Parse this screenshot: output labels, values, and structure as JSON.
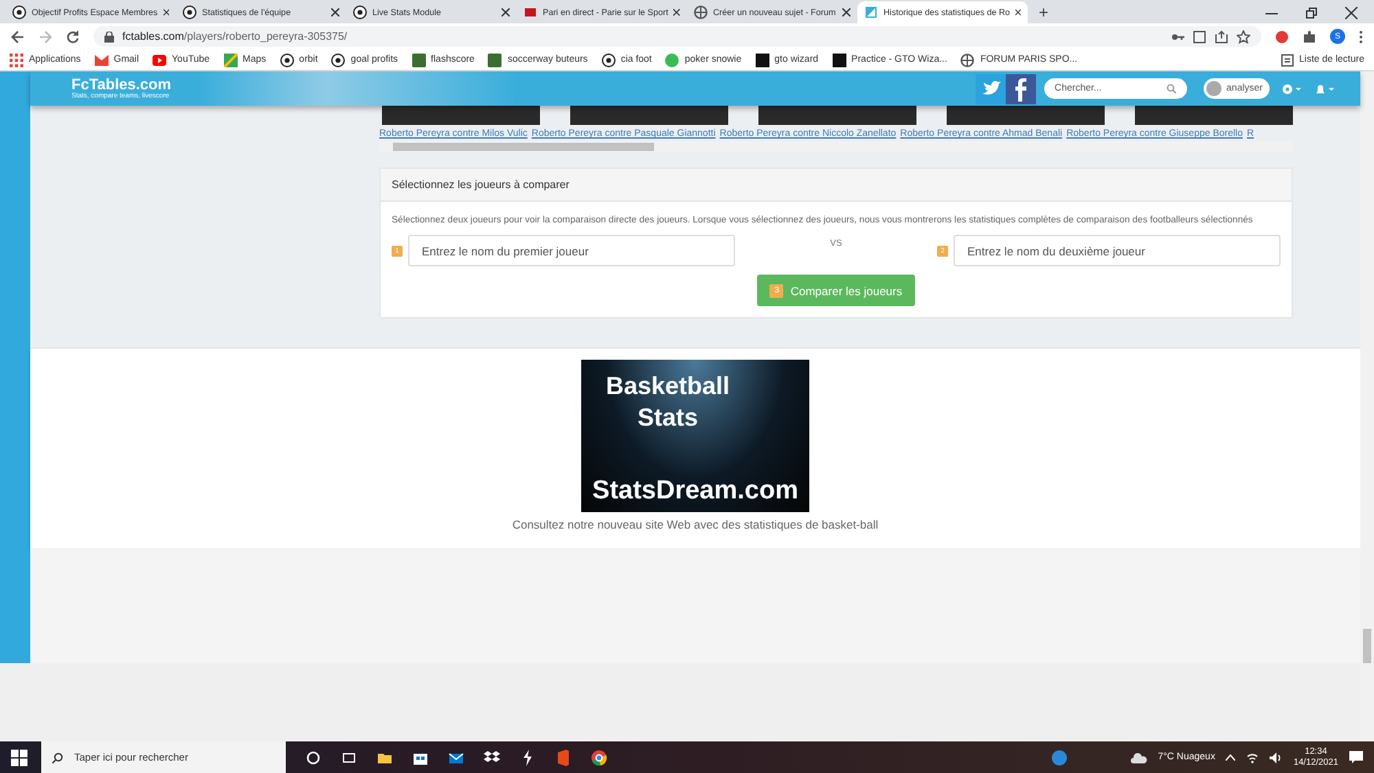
{
  "browser": {
    "tabs": [
      {
        "title": "Objectif Profits Espace Membres",
        "selected": false
      },
      {
        "title": "Statistiques de l'équipe",
        "selected": false
      },
      {
        "title": "Live Stats Module",
        "selected": false
      },
      {
        "title": "Pari en direct - Parie sur le Sport",
        "selected": false
      },
      {
        "title": "Créer un nouveau sujet - Forum",
        "selected": false
      },
      {
        "title": "Historique des statistiques de Ro",
        "selected": true
      }
    ],
    "new_tab": "+",
    "url_host": "fctables.com",
    "url_path": "/players/roberto_pereyra-305375/",
    "profile_initial": "S",
    "bookmarks": [
      "Applications",
      "Gmail",
      "YouTube",
      "Maps",
      "orbit",
      "goal profits",
      "flashscore",
      "soccerway buteurs",
      "cia foot",
      "poker snowie",
      "gto wizard",
      "Practice - GTO Wiza...",
      "FORUM PARIS SPO..."
    ],
    "reading_list": "Liste de lecture"
  },
  "site_header": {
    "logo": "FcTables.com",
    "tagline": "Stats, compare teams, livescore",
    "search_placeholder": "Chercher...",
    "user": "analyser"
  },
  "match_links": [
    "Roberto Pereyra contre Milos Vulic",
    "Roberto Pereyra contre Pasquale Giannotti",
    "Roberto Pereyra contre Niccolo Zanellato",
    "Roberto Pereyra contre Ahmad Benali",
    "Roberto Pereyra contre Giuseppe Borello",
    "R"
  ],
  "compare": {
    "title": "Sélectionnez les joueurs à comparer",
    "description": "Sélectionnez deux joueurs pour voir la comparaison directe des joueurs. Lorsque vous sélectionnez des joueurs, nous vous montrerons les statistiques complètes de comparaison des footballeurs sélectionnés",
    "player_fields": [
      {
        "step": "1",
        "placeholder": "Entrez le nom du premier joueur"
      },
      {
        "step": "2",
        "placeholder": "Entrez le nom du deuxième joueur"
      }
    ],
    "vs": "VS",
    "button_step": "3",
    "button": "Comparer les joueurs"
  },
  "promo": {
    "banner_title": "Basketball Stats",
    "banner_domain": "StatsDream.com",
    "caption": "Consultez notre nouveau site Web avec des statistiques de basket-ball"
  },
  "taskbar": {
    "search_placeholder": "Taper ici pour rechercher",
    "weather": "7°C  Nuageux",
    "time": "12:34",
    "date": "14/12/2021"
  }
}
